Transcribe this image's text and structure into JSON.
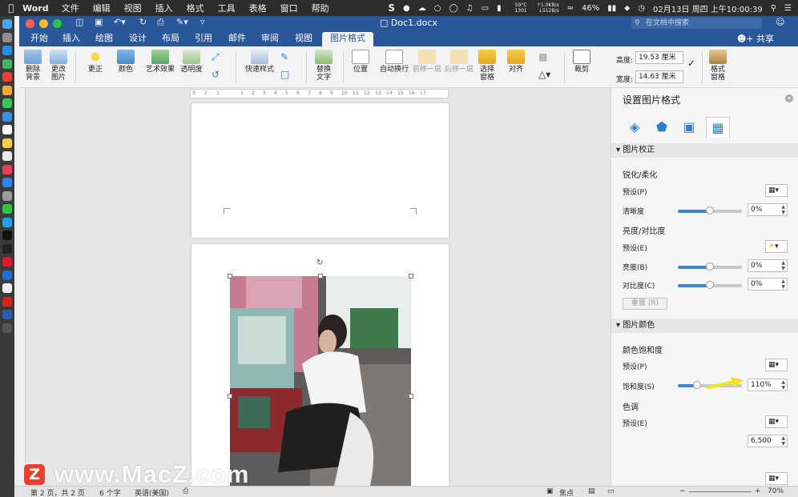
{
  "menubar": {
    "app": "Word",
    "items": [
      "文件",
      "编辑",
      "视图",
      "插入",
      "格式",
      "工具",
      "表格",
      "窗口",
      "帮助"
    ],
    "temp": "59°C 1301",
    "net": "↑1.0KB/s ↓512B/s",
    "datetime": "02月13日 周四 上午10:00:39",
    "battery": "46%"
  },
  "titlebar": {
    "doc_title": "Doc1.docx",
    "search_placeholder": "在文档中搜索"
  },
  "tabs": {
    "items": [
      "开始",
      "插入",
      "绘图",
      "设计",
      "布局",
      "引用",
      "邮件",
      "审阅",
      "视图"
    ],
    "active": "图片格式",
    "share": "共享"
  },
  "ribbon": {
    "remove_bg": "删除背景",
    "change_pic": "更改图片",
    "corrections": "更正",
    "color": "颜色",
    "artistic": "艺术效果",
    "transparency": "透明度",
    "quick_styles": "快速样式",
    "alt_text": "替换文字",
    "position": "位置",
    "wrap": "自动换行",
    "forward": "前移一层",
    "backward": "后移一层",
    "selection_pane": "选择窗格",
    "align": "对齐",
    "crop": "裁剪",
    "height_label": "高度:",
    "height_value": "19.53 厘米",
    "width_label": "宽度:",
    "width_value": "14.63 厘米",
    "format_pane": "格式窗格"
  },
  "pane": {
    "title": "设置图片格式",
    "sections": {
      "correction": "图片校正",
      "color": "图片颜色"
    },
    "sharpen_title": "锐化/柔化",
    "preset": "预设(P)",
    "sharpness": "清晰度",
    "sharpness_value": "0%",
    "brightness_title": "亮度/对比度",
    "preset_e": "预设(E)",
    "brightness": "亮度(B)",
    "brightness_value": "0%",
    "contrast": "对比度(C)",
    "contrast_value": "0%",
    "reset": "重置 (R)",
    "saturation_title": "颜色饱和度",
    "saturation_preset": "预设(P)",
    "saturation": "饱和度(S)",
    "saturation_value": "110%",
    "tone_title": "色调",
    "tone_preset": "预设(E)",
    "tone_value": "6,500"
  },
  "status": {
    "page": "第 2 页，共 2 页",
    "words": "6 个字",
    "lang": "英语(美国)",
    "focus": "焦点",
    "zoom": "70%"
  },
  "watermark": {
    "logo": "Z",
    "text": "www.MacZ.com"
  },
  "ruler": {
    "marks": [
      "3",
      "2",
      "1",
      "1",
      "2",
      "3",
      "4",
      "5",
      "6",
      "7",
      "8",
      "9",
      "10",
      "11",
      "12",
      "13",
      "14",
      "15",
      "16",
      "17"
    ]
  },
  "colors": {
    "accent": "#2a579a",
    "slider": "#3c86d6",
    "arrow": "#f5e22a"
  },
  "levels": {
    "sharpness": 0.5,
    "brightness": 0.5,
    "contrast": 0.5,
    "saturation": 0.3
  }
}
